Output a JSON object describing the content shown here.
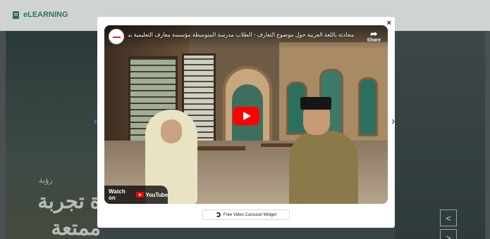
{
  "app": {
    "brand": "eLEARNING"
  },
  "background": {
    "eyebrow": "رؤية",
    "headline": "ة تجربة ممتعة",
    "controls": {
      "prev": "<",
      "next": ">"
    }
  },
  "modal": {
    "close_label": "×",
    "video": {
      "title": "محادثة باللغة العربية حول موضوع التعارف - الطلاب مدرسة المتوسطة مؤسسة معارف التعليمية بسونداجو",
      "share_label": "Share",
      "watch_on_label": "Watch on",
      "youtube_label": "YouTube"
    },
    "carousel": {
      "prev": "‹",
      "next": "›"
    },
    "widget_badge": "Free Video Carousel Widget"
  },
  "colors": {
    "brand": "#2f6f63",
    "play": "#ff0000",
    "nav": "#3b7fd6"
  }
}
